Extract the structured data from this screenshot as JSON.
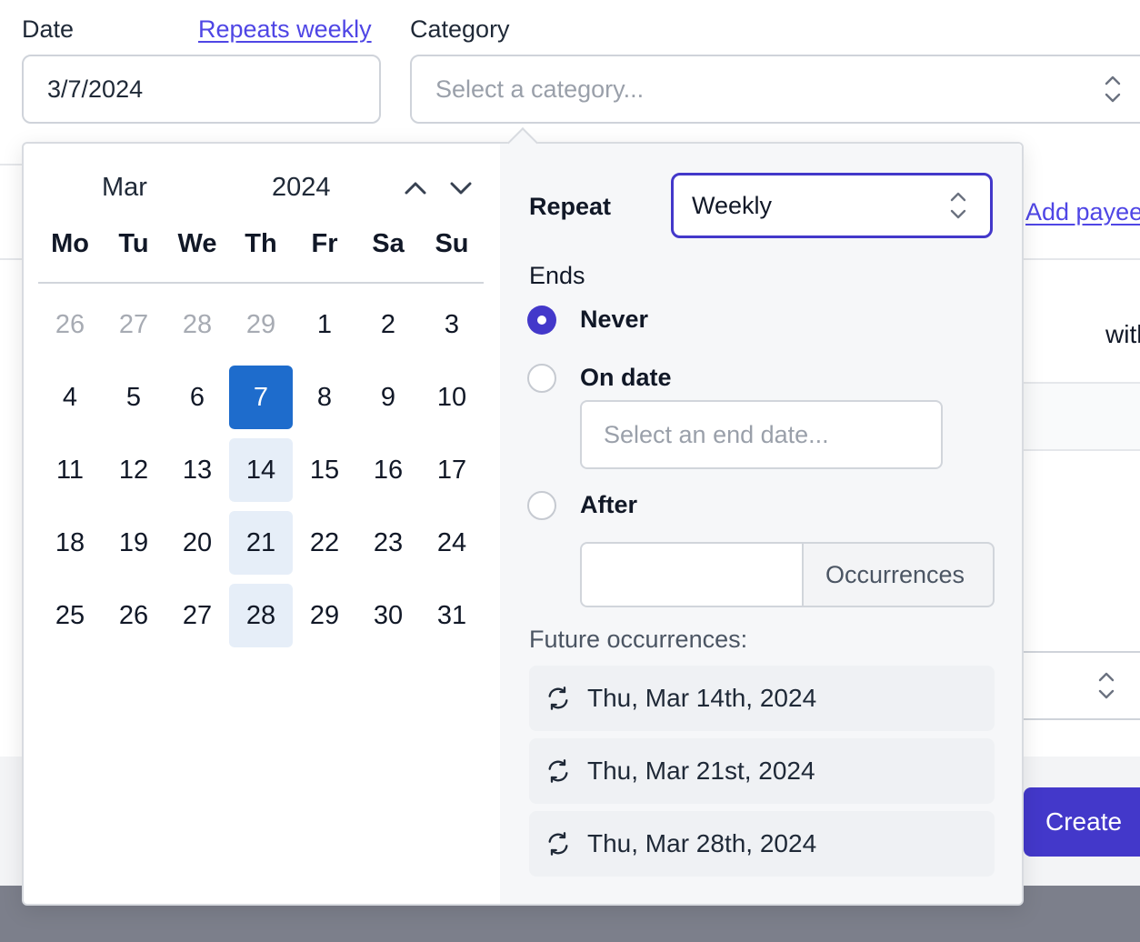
{
  "form": {
    "date_label": "Date",
    "repeats_link": "Repeats weekly",
    "date_value": "3/7/2024",
    "category_label": "Category",
    "category_placeholder": "Select a category...",
    "add_payee_link": "Add payee",
    "partial_text": "with",
    "create_button": "Create"
  },
  "calendar": {
    "month": "Mar",
    "year": "2024",
    "weekdays": [
      "Mo",
      "Tu",
      "We",
      "Th",
      "Fr",
      "Sa",
      "Su"
    ],
    "weeks": [
      [
        "26",
        "27",
        "28",
        "29",
        "1",
        "2",
        "3"
      ],
      [
        "4",
        "5",
        "6",
        "7",
        "8",
        "9",
        "10"
      ],
      [
        "11",
        "12",
        "13",
        "14",
        "15",
        "16",
        "17"
      ],
      [
        "18",
        "19",
        "20",
        "21",
        "22",
        "23",
        "24"
      ],
      [
        "25",
        "26",
        "27",
        "28",
        "29",
        "30",
        "31"
      ]
    ],
    "selected_day": "7",
    "repeat_days": [
      "14",
      "21",
      "28"
    ]
  },
  "repeat": {
    "repeat_label": "Repeat",
    "repeat_value": "Weekly",
    "ends_label": "Ends",
    "options": [
      {
        "label": "Never",
        "checked": true
      },
      {
        "label": "On date",
        "checked": false
      },
      {
        "label": "After",
        "checked": false
      }
    ],
    "end_date_placeholder": "Select an end date...",
    "occurrences_value": "",
    "occurrences_addon": "Occurrences",
    "future_label": "Future occurrences:",
    "future": [
      "Thu, Mar 14th, 2024",
      "Thu, Mar 21st, 2024",
      "Thu, Mar 28th, 2024"
    ]
  },
  "colors": {
    "accent": "#4338ca",
    "selected_day": "#1e6ccc",
    "repeat_day": "#e6eef8",
    "link": "#4f46e5"
  }
}
